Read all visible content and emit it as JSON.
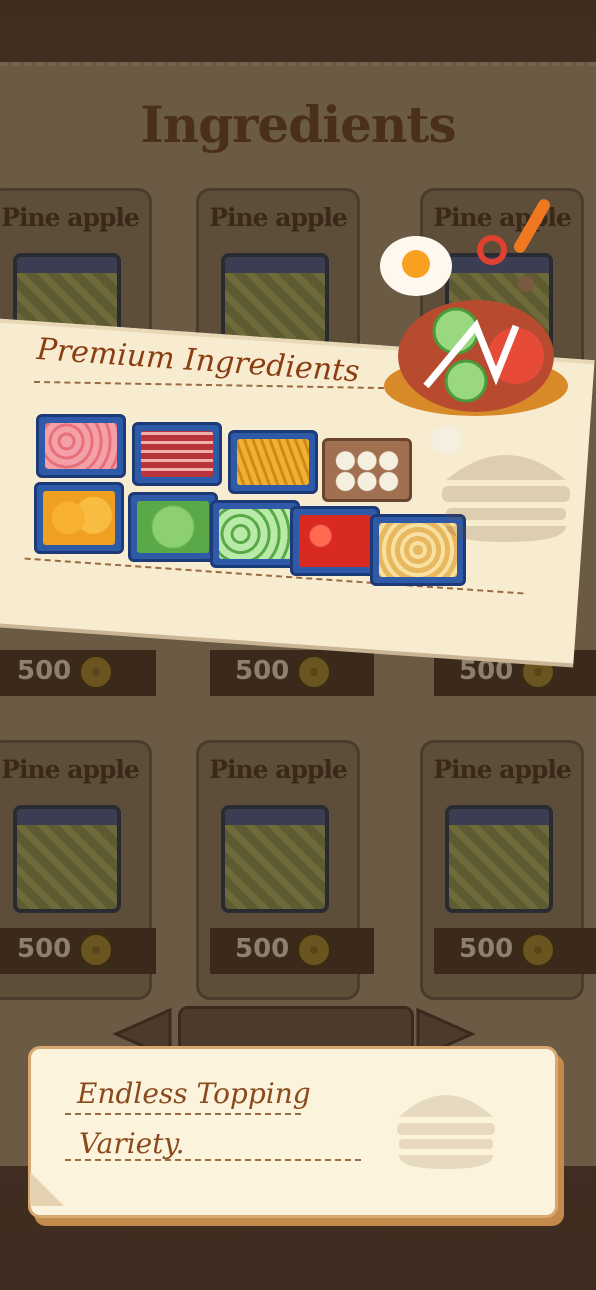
{
  "board": {
    "title": "Ingredients",
    "cards": [
      {
        "name": "Pine apple",
        "price": "500"
      },
      {
        "name": "Pine apple",
        "price": "500"
      },
      {
        "name": "Pine apple",
        "price": "500"
      },
      {
        "name": "",
        "price": "500"
      },
      {
        "name": "",
        "price": "500"
      },
      {
        "name": "",
        "price": "500"
      },
      {
        "name": "Pine apple",
        "price": "500"
      },
      {
        "name": "Pine apple",
        "price": "500"
      },
      {
        "name": "Pine apple",
        "price": "500"
      }
    ]
  },
  "banner": {
    "title": "Premium Ingredients",
    "ingredients": [
      "shrimp",
      "bacon",
      "fries",
      "eggs",
      "buns",
      "lettuce",
      "cucumber",
      "tomato",
      "onion rings"
    ]
  },
  "message": {
    "line1": "Endless Topping",
    "line2": "Variety."
  },
  "colors": {
    "accent": "#8a3c12",
    "paper": "#f8ecd0",
    "tray": "#2e5aa8"
  }
}
